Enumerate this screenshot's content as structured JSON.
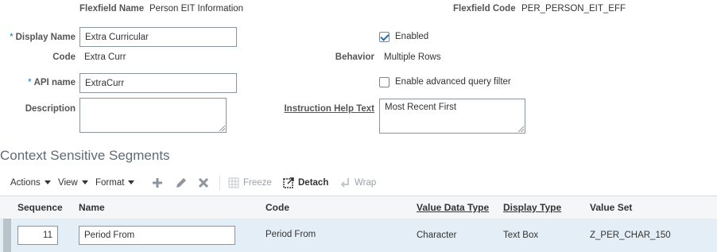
{
  "header": {
    "flexfield_name_label": "Flexfield Name",
    "flexfield_name_value": "Person EIT Information",
    "flexfield_code_label": "Flexfield Code",
    "flexfield_code_value": "PER_PERSON_EIT_EFF"
  },
  "form": {
    "required_marker": "*",
    "display_name_label": "Display Name",
    "display_name_value": "Extra Curricular",
    "code_label": "Code",
    "code_value": "Extra Curr",
    "api_name_label": "API name",
    "api_name_value": "ExtraCurr",
    "description_label": "Description",
    "description_value": "",
    "enabled_label": "Enabled",
    "enabled_checked": true,
    "behavior_label": "Behavior",
    "behavior_value": "Multiple Rows",
    "adv_query_label": "Enable advanced query filter",
    "adv_query_checked": false,
    "instruction_label": "Instruction Help Text",
    "instruction_value": "Most Recent First"
  },
  "segments": {
    "title": "Context Sensitive Segments",
    "toolbar": {
      "actions": "Actions",
      "view": "View",
      "format": "Format",
      "freeze": "Freeze",
      "detach": "Detach",
      "wrap": "Wrap",
      "icons": [
        "add-icon",
        "edit-icon",
        "delete-icon",
        "freeze-icon",
        "detach-icon",
        "wrap-icon"
      ]
    },
    "columns": [
      "Sequence",
      "Name",
      "Code",
      "Value Data Type",
      "Display Type",
      "Value Set"
    ],
    "rows": [
      {
        "sequence": "11",
        "name": "Period From",
        "code": "Period From",
        "value_data_type": "Character",
        "display_type": "Text Box",
        "value_set": "Z_PER_CHAR_150"
      }
    ]
  },
  "colors": {
    "accent": "#1a6fbf",
    "row_selected_bg": "#e4eef7",
    "header_bg": "#f4f6f7",
    "label_gray": "#555555"
  }
}
